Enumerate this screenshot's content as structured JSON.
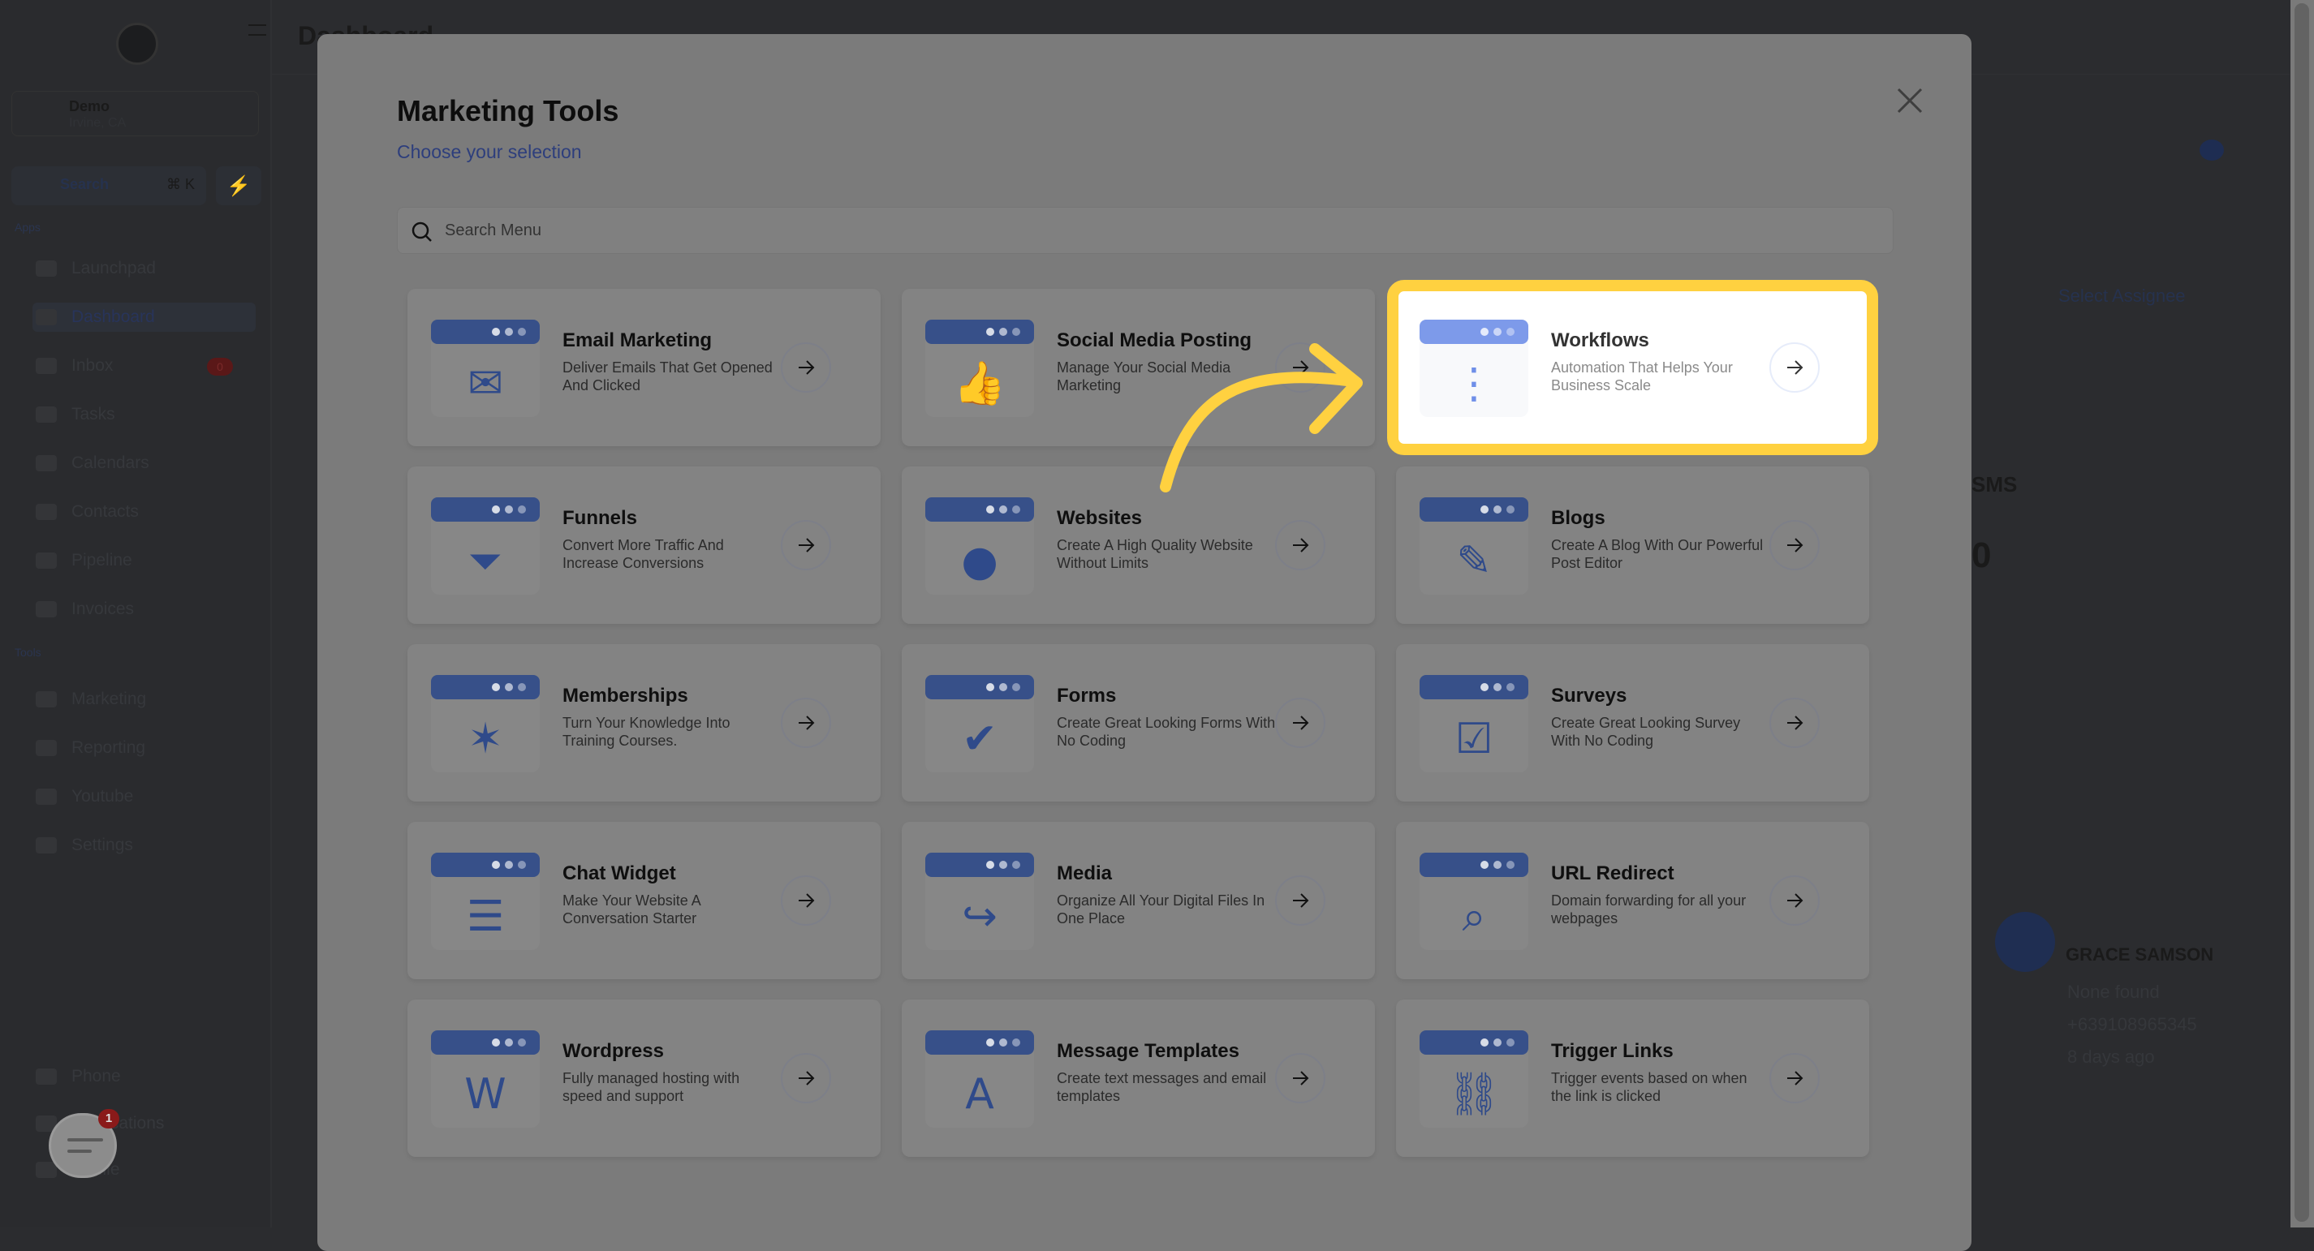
{
  "sidebar": {
    "location": {
      "name": "Demo",
      "sub": "Irvine, CA"
    },
    "search": {
      "label": "Search",
      "shortcut": "⌘ K"
    },
    "apps_label": "Apps",
    "tools_label": "Tools",
    "apps": [
      {
        "label": "Launchpad"
      },
      {
        "label": "Dashboard",
        "active": true
      },
      {
        "label": "Inbox",
        "badge": "0"
      },
      {
        "label": "Tasks"
      },
      {
        "label": "Calendars"
      },
      {
        "label": "Contacts"
      },
      {
        "label": "Pipeline"
      },
      {
        "label": "Invoices"
      }
    ],
    "tools": [
      {
        "label": "Marketing"
      },
      {
        "label": "Reporting"
      },
      {
        "label": "Youtube"
      },
      {
        "label": "Settings"
      }
    ],
    "bottom": [
      {
        "label": "Phone"
      },
      {
        "label": "Notifications"
      },
      {
        "label": "Profile"
      }
    ]
  },
  "header": {
    "title": "Dashboard"
  },
  "background_right": {
    "assignee_select": "Select Assignee",
    "sms_label": "SMS",
    "sms_value": "0",
    "contact": {
      "name": "GRACE SAMSON",
      "company": "None found",
      "phone": "+639108965345",
      "time": "8 days ago"
    }
  },
  "chat_widget": {
    "badge": "1"
  },
  "modal": {
    "title": "Marketing Tools",
    "subtitle": "Choose your selection",
    "search_placeholder": "Search Menu",
    "highlight_color": "#ffd140",
    "icon_color": "#2f4a8a",
    "highlight_icon_color": "#6f8fe8",
    "tools": [
      {
        "title": "Email Marketing",
        "desc": "Deliver Emails That Get Opened And Clicked",
        "icon": "email-icon"
      },
      {
        "title": "Social Media Posting",
        "desc": "Manage Your Social Media Marketing",
        "icon": "social-media-icon"
      },
      {
        "title": "Workflows",
        "desc": "Automation That Helps Your Business Scale",
        "icon": "workflow-icon",
        "highlighted": true
      },
      {
        "title": "Funnels",
        "desc": "Convert More Traffic And Increase Conversions",
        "icon": "funnel-icon"
      },
      {
        "title": "Websites",
        "desc": "Create A High Quality Website Without Limits",
        "icon": "website-icon"
      },
      {
        "title": "Blogs",
        "desc": "Create A Blog With Our Powerful Post Editor",
        "icon": "blog-pen-icon"
      },
      {
        "title": "Memberships",
        "desc": "Turn Your Knowledge Into Training Courses.",
        "icon": "membership-icon"
      },
      {
        "title": "Forms",
        "desc": "Create Great Looking Forms With No Coding",
        "icon": "form-icon"
      },
      {
        "title": "Surveys",
        "desc": "Create Great Looking Survey With No Coding",
        "icon": "survey-icon"
      },
      {
        "title": "Chat Widget",
        "desc": "Make Your Website A Conversation Starter",
        "icon": "chat-bubbles-icon"
      },
      {
        "title": "Media",
        "desc": "Organize All Your Digital Files In One Place",
        "icon": "media-share-icon"
      },
      {
        "title": "URL Redirect",
        "desc": "Domain forwarding for all your webpages",
        "icon": "www-magnifier-icon"
      },
      {
        "title": "Wordpress",
        "desc": "Fully managed hosting with speed and support",
        "icon": "wordpress-icon"
      },
      {
        "title": "Message Templates",
        "desc": "Create text messages and email templates",
        "icon": "message-template-icon"
      },
      {
        "title": "Trigger Links",
        "desc": "Trigger events based on when the link is clicked",
        "icon": "trigger-link-icon"
      }
    ]
  }
}
